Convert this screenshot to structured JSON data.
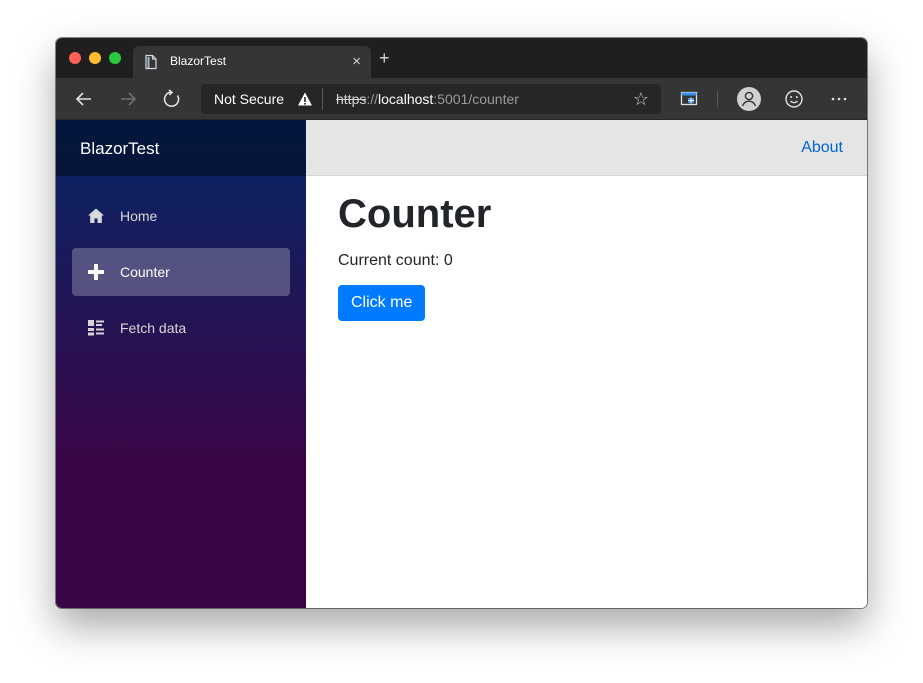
{
  "browser": {
    "tab": {
      "title": "BlazorTest",
      "close_glyph": "×",
      "favicon": "page-icon"
    },
    "new_tab_glyph": "+",
    "nav": {
      "back_icon": "back-arrow-icon",
      "forward_icon": "forward-arrow-icon",
      "reload_icon": "reload-icon"
    },
    "address_bar": {
      "security_label": "Not Secure",
      "security_icon": "warning-icon",
      "url_scheme": "https",
      "url_separator": "://",
      "url_host": "localhost",
      "url_rest": ":5001/counter",
      "favorite_glyph": "☆"
    },
    "toolbar": {
      "collections_icon": "collections-icon",
      "profile_icon": "profile-icon",
      "emoji_glyph": "☺",
      "more_glyph": "···"
    }
  },
  "app": {
    "brand": "BlazorTest",
    "top_link": "About",
    "nav_items": [
      {
        "label": "Home",
        "icon": "home-icon"
      },
      {
        "label": "Counter",
        "icon": "plus-icon",
        "active": true
      },
      {
        "label": "Fetch data",
        "icon": "list-icon"
      }
    ],
    "page": {
      "title": "Counter",
      "count_text": "Current count: 0",
      "button_label": "Click me"
    }
  },
  "colors": {
    "sidebar_top": "#052767",
    "sidebar_bottom": "#3a0647",
    "link": "#0366d6",
    "primary_button": "#007bff",
    "browser_chrome": "#353535"
  }
}
